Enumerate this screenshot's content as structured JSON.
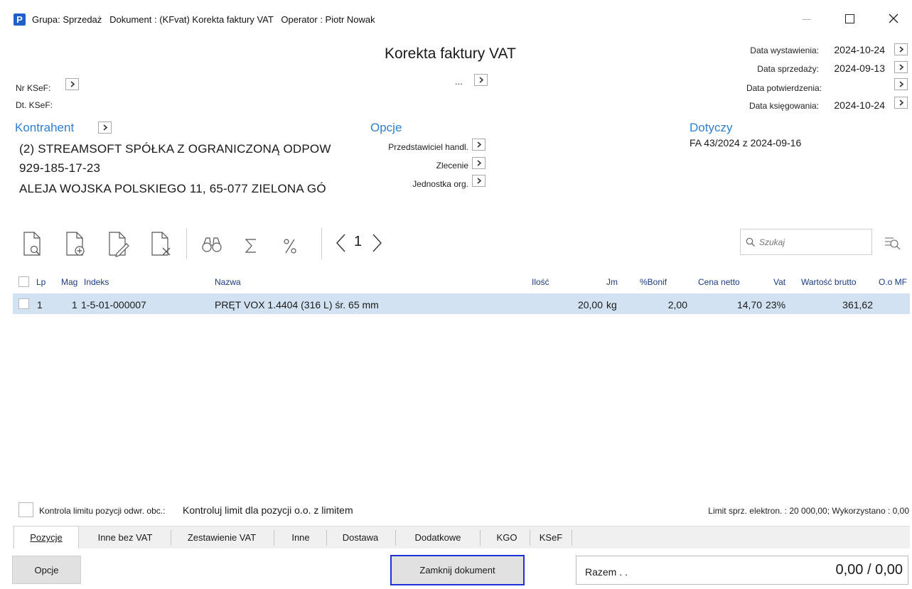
{
  "titlebar": {
    "app_icon_letter": "P",
    "title": "Grupa: Sprzedaż   Dokument : (KFvat) Korekta faktury VAT   Operator : Piotr Nowak"
  },
  "document": {
    "title": "Korekta faktury VAT",
    "number_placeholder": "..."
  },
  "ksef": {
    "nr_label": "Nr KSeF:",
    "dt_label": "Dt. KSeF:"
  },
  "dates": [
    {
      "label": "Data wystawienia:",
      "value": "2024-10-24"
    },
    {
      "label": "Data sprzedaży:",
      "value": "2024-09-13"
    },
    {
      "label": "Data potwierdzenia:",
      "value": ""
    },
    {
      "label": "Data księgowania:",
      "value": "2024-10-24"
    }
  ],
  "kontrahent": {
    "heading": "Kontrahent",
    "name": "(2) STREAMSOFT SPÓŁKA Z OGRANICZONĄ ODPOW",
    "nip": "929-185-17-23",
    "address": "ALEJA WOJSKA POLSKIEGO 11, 65-077 ZIELONA GÓ"
  },
  "opcje": {
    "heading": "Opcje",
    "items": [
      "Przedstawiciel handl.",
      "Zlecenie",
      "Jednostka org."
    ]
  },
  "dotyczy": {
    "heading": "Dotyczy",
    "value": "FA 43/2024 z 2024-09-16"
  },
  "toolbar": {
    "icons": [
      "document-preview-icon",
      "document-add-icon",
      "document-edit-icon",
      "document-delete-icon",
      "binoculars-icon",
      "sum-icon",
      "percent-icon"
    ],
    "page_number": "1",
    "search_placeholder": "Szukaj"
  },
  "table": {
    "headers": {
      "lp": "Lp",
      "mag": "Mag",
      "indeks": "Indeks",
      "nazwa": "Nazwa",
      "ilosc": "Ilość",
      "jm": "Jm",
      "bonif": "%Bonif",
      "cena": "Cena netto",
      "vat": "Vat",
      "wartosc": "Wartość brutto",
      "oo": "O.o MF"
    },
    "rows": [
      {
        "lp": "1",
        "mag": "1",
        "indeks": "1-5-01-000007",
        "nazwa": "PRĘT VOX 1.4404 (316 L) śr. 65 mm",
        "ilosc": "20,00",
        "jm": "kg",
        "bonif": "2,00",
        "cena": "14,70",
        "vat": "23%",
        "wartosc": "361,62",
        "oo": ""
      }
    ]
  },
  "limit": {
    "label": "Kontrola limitu pozycji odwr. obc.:",
    "value": "Kontroluj limit dla pozycji o.o. z limitem",
    "info": "Limit sprz. elektron. : 20 000,00; Wykorzystano : 0,00"
  },
  "tabs": [
    "Pozycje",
    "Inne bez VAT",
    "Zestawienie VAT",
    "Inne",
    "Dostawa",
    "Dodatkowe",
    "KGO",
    "KSeF"
  ],
  "footer": {
    "opcje_button": "Opcje",
    "close_button": "Zamknij dokument",
    "razem_label": "Razem . .",
    "razem_value": "0,00 / 0,00"
  },
  "colors": {
    "accent": "#2f7fd0",
    "selected_row": "#d3e2f2",
    "focus_border": "#1a32d8",
    "app_icon": "#2060c8"
  }
}
